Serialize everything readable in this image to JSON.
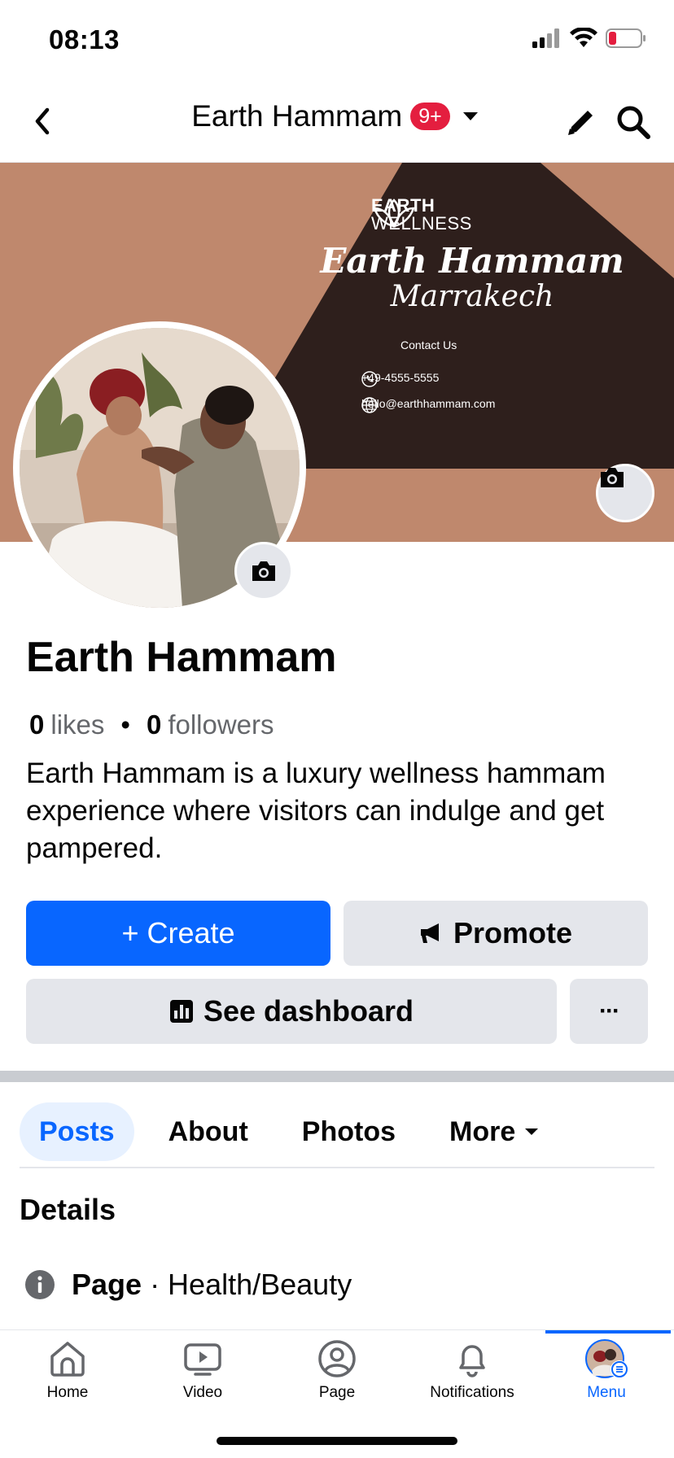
{
  "status_bar": {
    "time": "08:13"
  },
  "header": {
    "title": "Earth Hammam",
    "badge": "9+"
  },
  "cover": {
    "brand_line1": "EARTH",
    "brand_line2": "WELLNESS",
    "name": "Earth Hammam",
    "city": "Marrakech",
    "contact_title": "Contact Us",
    "phone": "+49-4555-5555",
    "email": "hello@earthhammam.com"
  },
  "profile": {
    "name": "Earth Hammam",
    "likes_count": "0",
    "likes_label": "likes",
    "followers_count": "0",
    "followers_label": "followers",
    "bio": "Earth Hammam is a luxury wellness hammam experience where visitors can indulge and get pampered."
  },
  "actions": {
    "create": "+ Create",
    "promote": "Promote",
    "dashboard": "See dashboard",
    "more": "···"
  },
  "tabs": [
    {
      "label": "Posts",
      "active": true
    },
    {
      "label": "About"
    },
    {
      "label": "Photos"
    },
    {
      "label": "More"
    }
  ],
  "details": {
    "heading": "Details",
    "page_label": "Page",
    "category": "· Health/Beauty"
  },
  "bottom_nav": [
    {
      "label": "Home",
      "icon": "home-icon"
    },
    {
      "label": "Video",
      "icon": "video-icon"
    },
    {
      "label": "Page",
      "icon": "page-icon"
    },
    {
      "label": "Notifications",
      "icon": "bell-icon"
    },
    {
      "label": "Menu",
      "icon": "menu-avatar-icon",
      "active": true
    }
  ],
  "colors": {
    "accent": "#0866ff",
    "badge": "#e41e3f",
    "cover_tan": "#bf886d",
    "cover_dark": "#2e1f1c",
    "button_gray": "#e4e6eb"
  }
}
